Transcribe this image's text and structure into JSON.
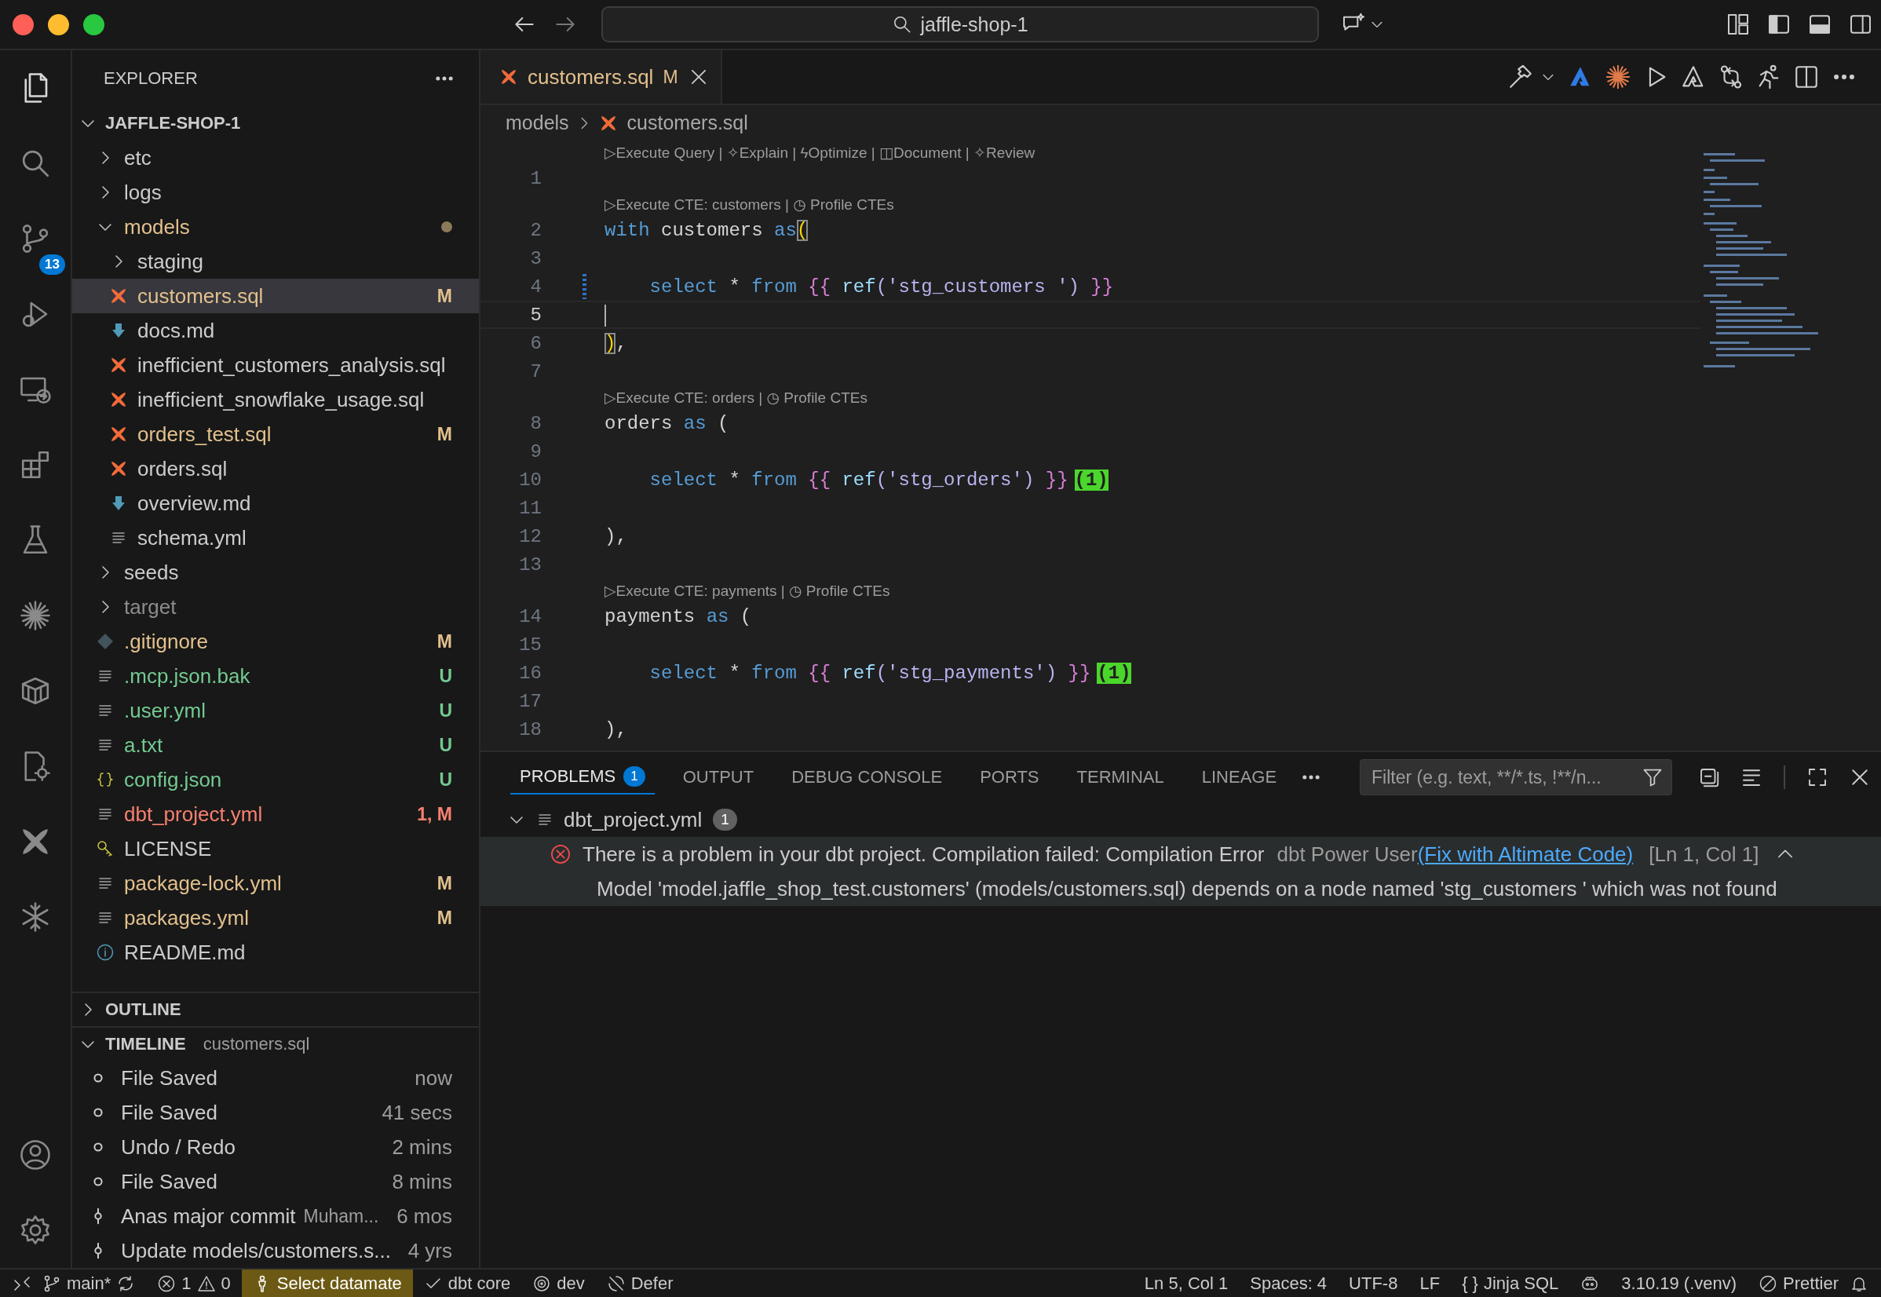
{
  "title_bar": {
    "search": "jaffle-shop-1"
  },
  "activity_bar": {
    "badge": "13"
  },
  "explorer": {
    "title": "EXPLORER",
    "root": {
      "label": "JAFFLE-SHOP-1",
      "expanded": true
    },
    "items": [
      {
        "label": "etc",
        "kind": "folder",
        "expanded": false,
        "dot": false,
        "selected": false,
        "color": "#cccccc"
      },
      {
        "label": "logs",
        "kind": "folder",
        "expanded": false,
        "dot": false,
        "selected": false,
        "color": "#cccccc"
      },
      {
        "label": "models",
        "kind": "folder",
        "expanded": true,
        "dot": true,
        "selected": false,
        "color": "#e2c08d",
        "children": [
          {
            "label": "staging",
            "kind": "folder",
            "expanded": false,
            "dot": false,
            "selected": false,
            "color": "#cccccc"
          },
          {
            "label": "customers.sql",
            "kind": "dbt",
            "status": "M",
            "selected": true,
            "color": "#e2c08d"
          },
          {
            "label": "docs.md",
            "kind": "markdown",
            "selected": false,
            "color": "#cccccc"
          },
          {
            "label": "inefficient_customers_analysis.sql",
            "kind": "dbt",
            "selected": false,
            "color": "#cccccc"
          },
          {
            "label": "inefficient_snowflake_usage.sql",
            "kind": "dbt",
            "selected": false,
            "color": "#cccccc"
          },
          {
            "label": "orders_test.sql",
            "kind": "dbt",
            "status": "M",
            "selected": false,
            "color": "#e2c08d"
          },
          {
            "label": "orders.sql",
            "kind": "dbt",
            "selected": false,
            "color": "#cccccc"
          },
          {
            "label": "overview.md",
            "kind": "markdown",
            "selected": false,
            "color": "#cccccc"
          },
          {
            "label": "schema.yml",
            "kind": "text",
            "selected": false,
            "color": "#cccccc"
          }
        ]
      },
      {
        "label": "seeds",
        "kind": "folder",
        "expanded": false,
        "dot": false,
        "selected": false,
        "color": "#cccccc"
      },
      {
        "label": "target",
        "kind": "folder",
        "expanded": false,
        "dot": false,
        "selected": false,
        "color": "#8c8c8c"
      },
      {
        "label": ".gitignore",
        "kind": "git",
        "status": "M",
        "selected": false,
        "color": "#e2c08d"
      },
      {
        "label": ".mcp.json.bak",
        "kind": "text",
        "status": "U",
        "selected": false,
        "color": "#73c991"
      },
      {
        "label": ".user.yml",
        "kind": "text",
        "status": "U",
        "selected": false,
        "color": "#73c991"
      },
      {
        "label": "a.txt",
        "kind": "text",
        "status": "U",
        "selected": false,
        "color": "#73c991"
      },
      {
        "label": "config.json",
        "kind": "json",
        "status": "U",
        "selected": false,
        "color": "#73c991"
      },
      {
        "label": "dbt_project.yml",
        "kind": "text",
        "status": "1, M",
        "selected": false,
        "color": "#f88070"
      },
      {
        "label": "LICENSE",
        "kind": "license",
        "selected": false,
        "color": "#cccccc"
      },
      {
        "label": "package-lock.yml",
        "kind": "text",
        "status": "M",
        "selected": false,
        "color": "#e2c08d"
      },
      {
        "label": "packages.yml",
        "kind": "text",
        "status": "M",
        "selected": false,
        "color": "#e2c08d"
      },
      {
        "label": "README.md",
        "kind": "info",
        "selected": false,
        "color": "#cccccc"
      }
    ]
  },
  "outline": {
    "title": "OUTLINE",
    "expanded": false
  },
  "timeline": {
    "title": "TIMELINE",
    "file": "customers.sql",
    "expanded": true,
    "items": [
      {
        "label": "File Saved",
        "kind": "local",
        "time": "now"
      },
      {
        "label": "File Saved",
        "kind": "local",
        "time": "41 secs"
      },
      {
        "label": "Undo / Redo",
        "kind": "local",
        "time": "2 mins"
      },
      {
        "label": "File Saved",
        "kind": "local",
        "time": "8 mins"
      },
      {
        "label": "Anas major commit",
        "kind": "commit",
        "detail": "Muham...",
        "time": "6 mos"
      },
      {
        "label": "Update models/customers.s...",
        "kind": "commit",
        "time": "4 yrs"
      }
    ]
  },
  "editor": {
    "tabs": [
      {
        "label": "customers.sql",
        "status": "M",
        "color": "#e2c08d",
        "selected": true
      }
    ],
    "breadcrumb": [
      "models",
      "customers.sql"
    ],
    "lines": [
      {
        "num": "1",
        "codelens": "▷Execute Query | ✧Explain | ϟOptimize | ◫Document | ✧Review"
      },
      {
        "num": "2",
        "codelens": "▷Execute CTE: customers | ◷ Profile CTEs",
        "tokens": [
          {
            "text": "with",
            "kind": "kw"
          },
          {
            "text": " customers ",
            "kind": "id"
          },
          {
            "text": "as",
            "kind": "kw"
          },
          {
            "text": "(",
            "kind": "match"
          }
        ]
      },
      {
        "num": "3"
      },
      {
        "num": "4",
        "modified": true,
        "tokens": [
          {
            "text": "    select",
            "kind": "kw"
          },
          {
            "text": " * ",
            "kind": "id"
          },
          {
            "text": "from",
            "kind": "kw"
          },
          {
            "text": " {{ ",
            "kind": "brace"
          },
          {
            "text": "ref",
            "kind": "func"
          },
          {
            "text": "('stg_customers ')",
            "kind": "str"
          },
          {
            "text": " }}",
            "kind": "brace"
          }
        ]
      },
      {
        "num": "5",
        "current": true
      },
      {
        "num": "6",
        "tokens": [
          {
            "text": ")",
            "kind": "match"
          },
          {
            "text": ",",
            "kind": "id"
          }
        ]
      },
      {
        "num": "7"
      },
      {
        "num": "8",
        "codelens": "▷Execute CTE: orders | ◷ Profile CTEs",
        "tokens": [
          {
            "text": "orders ",
            "kind": "id"
          },
          {
            "text": "as",
            "kind": "kw"
          },
          {
            "text": " (",
            "kind": "id"
          }
        ]
      },
      {
        "num": "9"
      },
      {
        "num": "10",
        "tokens": [
          {
            "text": "    select",
            "kind": "kw"
          },
          {
            "text": " * ",
            "kind": "id"
          },
          {
            "text": "from",
            "kind": "kw"
          },
          {
            "text": " {{ ",
            "kind": "brace"
          },
          {
            "text": "ref",
            "kind": "func"
          },
          {
            "text": "('stg_orders')",
            "kind": "str"
          },
          {
            "text": " }}",
            "kind": "brace"
          },
          {
            "text": "(1)",
            "kind": "badge"
          }
        ]
      },
      {
        "num": "11"
      },
      {
        "num": "12",
        "tokens": [
          {
            "text": "),",
            "kind": "id"
          }
        ]
      },
      {
        "num": "13"
      },
      {
        "num": "14",
        "codelens": "▷Execute CTE: payments | ◷ Profile CTEs",
        "tokens": [
          {
            "text": "payments ",
            "kind": "id"
          },
          {
            "text": "as",
            "kind": "kw"
          },
          {
            "text": " (",
            "kind": "id"
          }
        ]
      },
      {
        "num": "15"
      },
      {
        "num": "16",
        "tokens": [
          {
            "text": "    select",
            "kind": "kw"
          },
          {
            "text": " * ",
            "kind": "id"
          },
          {
            "text": "from",
            "kind": "kw"
          },
          {
            "text": " {{ ",
            "kind": "brace"
          },
          {
            "text": "ref",
            "kind": "func"
          },
          {
            "text": "('stg_payments')",
            "kind": "str"
          },
          {
            "text": " }}",
            "kind": "brace"
          },
          {
            "text": "(1)",
            "kind": "badge"
          }
        ]
      },
      {
        "num": "17"
      },
      {
        "num": "18",
        "tokens": [
          {
            "text": "),",
            "kind": "id"
          }
        ]
      }
    ]
  },
  "panel": {
    "tabs": [
      {
        "label": "PROBLEMS",
        "badge": "1",
        "selected": true
      },
      {
        "label": "OUTPUT",
        "selected": false
      },
      {
        "label": "DEBUG CONSOLE",
        "selected": false
      },
      {
        "label": "PORTS",
        "selected": false
      },
      {
        "label": "TERMINAL",
        "selected": false
      },
      {
        "label": "LINEAGE",
        "selected": false
      }
    ],
    "filter": {
      "placeholder": "Filter (e.g. text, **/*.ts, !**/n..."
    },
    "problems": [
      {
        "file": "dbt_project.yml",
        "count": "1",
        "expanded": true,
        "items": [
          {
            "message": "There is a problem in your dbt project. Compilation failed: Compilation Error",
            "source": "dbt Power User",
            "link": "(Fix with Altimate Code)",
            "location": "[Ln 1, Col 1]",
            "detail": "Model 'model.jaffle_shop_test.customers' (models/customers.sql) depends on a node named 'stg_customers ' which was not found",
            "selected": true
          }
        ]
      }
    ]
  },
  "status_bar": {
    "left": [
      {
        "kind": "branch",
        "text": "main*"
      },
      {
        "kind": "problems",
        "errors": "1",
        "warnings": "0"
      },
      {
        "kind": "highlight",
        "text": "Select datamate"
      },
      {
        "kind": "check",
        "text": "dbt core"
      },
      {
        "kind": "target",
        "text": "dev"
      },
      {
        "kind": "defer",
        "text": "Defer"
      }
    ],
    "right": [
      {
        "kind": "plain",
        "text": "Ln 5, Col 1"
      },
      {
        "kind": "plain",
        "text": "Spaces: 4"
      },
      {
        "kind": "plain",
        "text": "UTF-8"
      },
      {
        "kind": "plain",
        "text": "LF"
      },
      {
        "kind": "language",
        "icon_text": "{ }",
        "text": "Jinja SQL"
      },
      {
        "kind": "copilot"
      },
      {
        "kind": "plain",
        "text": "3.10.19 (.venv)"
      },
      {
        "kind": "prettier",
        "text": "Prettier"
      }
    ]
  }
}
